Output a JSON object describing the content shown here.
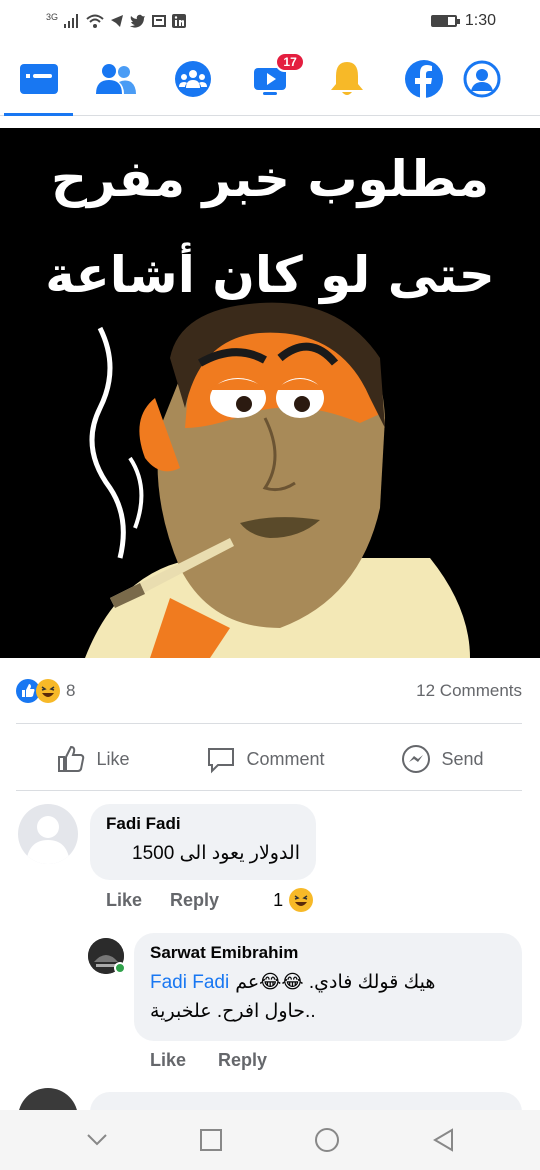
{
  "status_bar": {
    "network": "3G",
    "time": "1:30"
  },
  "tabs": [
    {
      "name": "news-feed",
      "icon": "news-feed-icon",
      "active": true
    },
    {
      "name": "friends",
      "icon": "friends-icon",
      "active": false
    },
    {
      "name": "groups",
      "icon": "groups-icon",
      "active": false
    },
    {
      "name": "watch",
      "icon": "watch-icon",
      "badge": "17",
      "active": false
    },
    {
      "name": "notifications",
      "icon": "bell-icon",
      "active": false
    },
    {
      "name": "facebook",
      "icon": "facebook-icon",
      "active": false
    },
    {
      "name": "profile",
      "icon": "profile-icon",
      "active": false
    }
  ],
  "post": {
    "image_text_line1": "مطلوب خبر مفرح",
    "image_text_line2": "حتى لو كان أشاعة",
    "reaction_count": "8",
    "comments_count": "12 Comments"
  },
  "actions": {
    "like": "Like",
    "comment": "Comment",
    "send": "Send"
  },
  "comments": [
    {
      "author": "Fadi Fadi",
      "text": "الدولار يعود الى 1500",
      "like": "Like",
      "reply": "Reply",
      "reaction_count": "1"
    },
    {
      "author": "Sarwat Emibrahim",
      "mention": "Fadi Fadi",
      "text_line1": "هيك قولك فادي. 😂😂عم",
      "text_line2": "..حاول افرح. علخبرية",
      "like": "Like",
      "reply": "Reply"
    }
  ],
  "colors": {
    "accent": "#1877f2",
    "badge": "#e41e3f",
    "meta_text": "#65676b",
    "bubble": "#f0f2f5"
  }
}
